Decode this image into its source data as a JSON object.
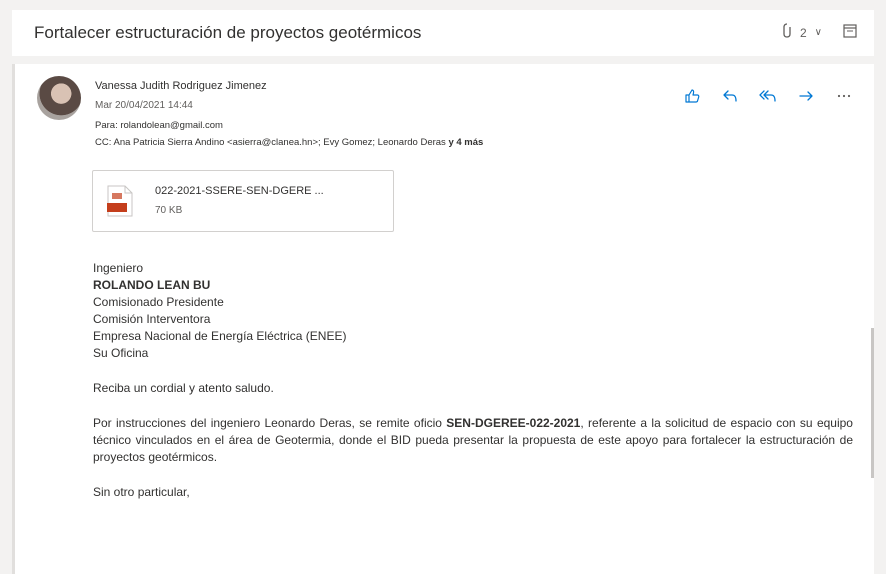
{
  "thread": {
    "title": "Fortalecer estructuración de proyectos geotérmicos",
    "attachment_count": "2",
    "attachment_chevron": "∨"
  },
  "message": {
    "sender": "Vanessa Judith Rodriguez Jimenez",
    "date": "Mar 20/04/2021 14:44",
    "to_label": "Para:",
    "to": "rolandolean@gmail.com",
    "cc_label": "CC:",
    "cc": "Ana Patricia Sierra Andino <asierra@clanea.hn>; Evy Gomez; Leonardo Deras",
    "cc_more": "y 4 más",
    "actions": [
      {
        "name": "like-button",
        "icon": "thumbs-up-icon"
      },
      {
        "name": "reply-button",
        "icon": "reply-icon"
      },
      {
        "name": "reply-all-button",
        "icon": "reply-all-icon"
      },
      {
        "name": "forward-button",
        "icon": "forward-icon"
      },
      {
        "name": "more-actions-button",
        "icon": "more-icon"
      }
    ]
  },
  "attachment": {
    "name": "022-2021-SSERE-SEN-DGERE ...",
    "size": "70 KB",
    "icon": "pdf-file-icon"
  },
  "body": {
    "salutation": "Ingeniero",
    "recipient_name": "ROLANDO LEAN BU",
    "recipient_title": "Comisionado Presidente",
    "recipient_org1": "Comisión Interventora",
    "recipient_org2": "Empresa Nacional de Energía Eléctrica (ENEE)",
    "recipient_office": "Su Oficina",
    "greeting": "Reciba un cordial y atento saludo.",
    "para_start": "Por instrucciones del ingeniero Leonardo Deras, se remite oficio ",
    "para_bold": "SEN-DGEREE-022-2021",
    "para_end": ", referente a la solicitud de espacio con su equipo técnico vinculados en el área de Geotermia, donde el BID pueda presentar la propuesta de este apoyo para fortalecer la estructuración de proyectos geotérmicos.",
    "closing": "Sin otro particular,"
  },
  "colors": {
    "accent": "#0078d4",
    "pdf": "#c43e1c"
  }
}
